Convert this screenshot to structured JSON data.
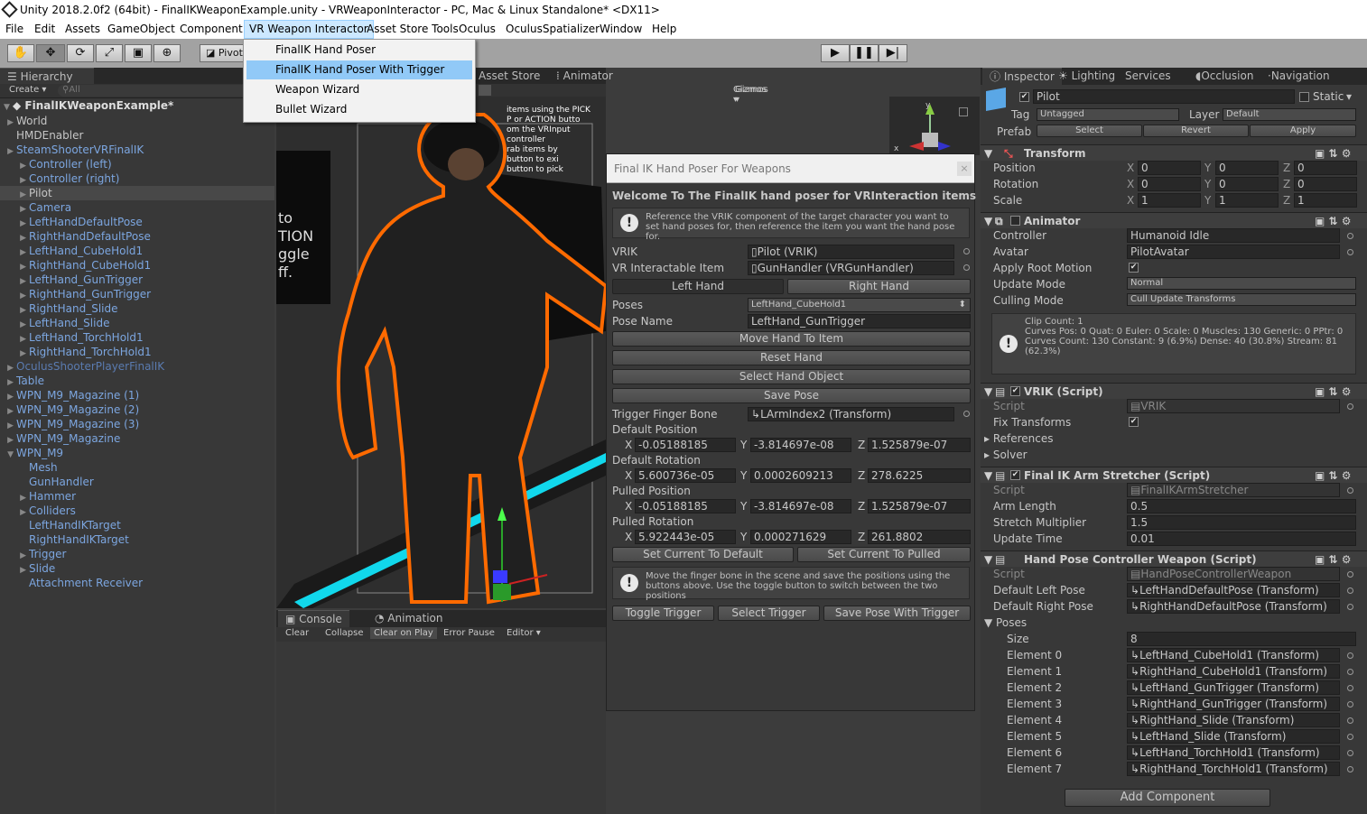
{
  "window": {
    "title": "Unity 2018.2.0f2 (64bit) - FinalIKWeaponExample.unity - VRWeaponInteractor - PC, Mac & Linux Standalone* <DX11>"
  },
  "menubar": [
    "File",
    "Edit",
    "Assets",
    "GameObject",
    "Component",
    "VR Weapon Interactor",
    "Asset Store Tools",
    "Oculus",
    "OculusSpatializer",
    "Window",
    "Help"
  ],
  "dropdown": [
    "FinalIK Hand Poser",
    "FinalIK Hand Poser With Trigger",
    "Weapon Wizard",
    "Bullet Wizard"
  ],
  "toolbar": {
    "pivot": "Pivot"
  },
  "hierarchy": {
    "tab": "Hierarchy",
    "create": "Create",
    "search": "All",
    "scene": "FinalIKWeaponExample*",
    "items": [
      {
        "label": "World",
        "indent": 1,
        "color": "grey",
        "arrow": true
      },
      {
        "label": "HMDEnabler",
        "indent": 1,
        "color": "grey",
        "arrow": false
      },
      {
        "label": "SteamShooterVRFinalIK",
        "indent": 1,
        "color": "blue",
        "arrow": true
      },
      {
        "label": "Controller (left)",
        "indent": 2,
        "color": "blue",
        "arrow": true
      },
      {
        "label": "Controller (right)",
        "indent": 2,
        "color": "blue",
        "arrow": true
      },
      {
        "label": "Pilot",
        "indent": 2,
        "color": "grey",
        "arrow": true,
        "selected": true
      },
      {
        "label": "Camera",
        "indent": 2,
        "color": "blue",
        "arrow": true
      },
      {
        "label": "LeftHandDefaultPose",
        "indent": 2,
        "color": "blue",
        "arrow": true
      },
      {
        "label": "RightHandDefaultPose",
        "indent": 2,
        "color": "blue",
        "arrow": true
      },
      {
        "label": "LeftHand_CubeHold1",
        "indent": 2,
        "color": "blue",
        "arrow": true
      },
      {
        "label": "RightHand_CubeHold1",
        "indent": 2,
        "color": "blue",
        "arrow": true
      },
      {
        "label": "LeftHand_GunTrigger",
        "indent": 2,
        "color": "blue",
        "arrow": true
      },
      {
        "label": "RightHand_GunTrigger",
        "indent": 2,
        "color": "blue",
        "arrow": true
      },
      {
        "label": "RightHand_Slide",
        "indent": 2,
        "color": "blue",
        "arrow": true
      },
      {
        "label": "LeftHand_Slide",
        "indent": 2,
        "color": "blue",
        "arrow": true
      },
      {
        "label": "LeftHand_TorchHold1",
        "indent": 2,
        "color": "blue",
        "arrow": true
      },
      {
        "label": "RightHand_TorchHold1",
        "indent": 2,
        "color": "blue",
        "arrow": true
      },
      {
        "label": "OculusShooterPlayerFinalIK",
        "indent": 1,
        "color": "dimblue",
        "arrow": true
      },
      {
        "label": "Table",
        "indent": 1,
        "color": "blue",
        "arrow": true
      },
      {
        "label": "WPN_M9_Magazine (1)",
        "indent": 1,
        "color": "blue",
        "arrow": true
      },
      {
        "label": "WPN_M9_Magazine (2)",
        "indent": 1,
        "color": "blue",
        "arrow": true
      },
      {
        "label": "WPN_M9_Magazine (3)",
        "indent": 1,
        "color": "blue",
        "arrow": true
      },
      {
        "label": "WPN_M9_Magazine",
        "indent": 1,
        "color": "blue",
        "arrow": true
      },
      {
        "label": "WPN_M9",
        "indent": 1,
        "color": "blue",
        "arrow": true,
        "open": true
      },
      {
        "label": "Mesh",
        "indent": 2,
        "color": "blue",
        "arrow": false
      },
      {
        "label": "GunHandler",
        "indent": 2,
        "color": "blue",
        "arrow": false
      },
      {
        "label": "Hammer",
        "indent": 2,
        "color": "blue",
        "arrow": true
      },
      {
        "label": "Colliders",
        "indent": 2,
        "color": "blue",
        "arrow": true
      },
      {
        "label": "LeftHandIKTarget",
        "indent": 2,
        "color": "blue",
        "arrow": false
      },
      {
        "label": "RightHandIKTarget",
        "indent": 2,
        "color": "blue",
        "arrow": false
      },
      {
        "label": "Trigger",
        "indent": 2,
        "color": "blue",
        "arrow": true
      },
      {
        "label": "Slide",
        "indent": 2,
        "color": "blue",
        "arrow": true
      },
      {
        "label": "Attachment Receiver",
        "indent": 2,
        "color": "blue",
        "arrow": false
      }
    ]
  },
  "scene": {
    "tabs": [
      "Asset Store",
      "Animator"
    ],
    "gizmos": "Gizmos",
    "search": "All",
    "text_lines": [
      "items using the PICK",
      "P or ACTION butto",
      "om the VRInput",
      "controller",
      "rab items by",
      "button to exi",
      "button to pick",
      "Ttion."
    ],
    "big_text": [
      "to",
      "TION",
      "ggle",
      "ff."
    ]
  },
  "poser": {
    "title": "Final IK Hand Poser For Weapons",
    "welcome": "Welcome To The FinalIK hand poser for VRInteraction items",
    "help1": "Reference the VRIK component of the target character you want to set hand poses for, then reference the item you want the hand pose for.",
    "vrik_label": "VRIK",
    "vrik_value": "Pilot (VRIK)",
    "item_label": "VR Interactable Item",
    "item_value": "GunHandler (VRGunHandler)",
    "left_hand": "Left Hand",
    "right_hand": "Right Hand",
    "poses_label": "Poses",
    "poses_value": "LeftHand_CubeHold1",
    "pose_name_label": "Pose Name",
    "pose_name_value": "LeftHand_GunTrigger",
    "buttons": [
      "Move Hand To Item",
      "Reset Hand",
      "Select Hand Object",
      "Save Pose"
    ],
    "trigger_bone_label": "Trigger Finger Bone",
    "trigger_bone_value": "LArmIndex2 (Transform)",
    "vectors": [
      {
        "label": "Default Position",
        "x": "-0.05188185",
        "y": "-3.814697e-08",
        "z": "1.525879e-07"
      },
      {
        "label": "Default Rotation",
        "x": "5.600736e-05",
        "y": "0.0002609213",
        "z": "278.6225"
      },
      {
        "label": "Pulled Position",
        "x": "-0.05188185",
        "y": "-3.814697e-08",
        "z": "1.525879e-07"
      },
      {
        "label": "Pulled Rotation",
        "x": "5.922443e-05",
        "y": "0.000271629",
        "z": "261.8802"
      }
    ],
    "set_default": "Set Current To Default",
    "set_pulled": "Set Current To Pulled",
    "help2": "Move the finger bone in the scene and save the positions using the buttons above. Use the toggle button to switch between the two positions",
    "bottom_buttons": [
      "Toggle Trigger",
      "Select Trigger",
      "Save Pose With Trigger"
    ]
  },
  "console": {
    "tabs": [
      "Console",
      "Animation"
    ],
    "buttons": [
      "Clear",
      "Collapse",
      "Clear on Play",
      "Error Pause",
      "Editor"
    ]
  },
  "inspector": {
    "tabs": [
      "Inspector",
      "Lighting",
      "Services",
      "Occlusion",
      "Navigation"
    ],
    "name": "Pilot",
    "static": "Static",
    "tag_label": "Tag",
    "tag": "Untagged",
    "layer_label": "Layer",
    "layer": "Default",
    "prefab_label": "Prefab",
    "prefab_buttons": [
      "Select",
      "Revert",
      "Apply"
    ],
    "transform": {
      "title": "Transform",
      "rows": [
        {
          "label": "Position",
          "x": "0",
          "y": "0",
          "z": "0"
        },
        {
          "label": "Rotation",
          "x": "0",
          "y": "0",
          "z": "0"
        },
        {
          "label": "Scale",
          "x": "1",
          "y": "1",
          "z": "1"
        }
      ]
    },
    "animator": {
      "title": "Animator",
      "rows": [
        {
          "label": "Controller",
          "value": "Humanoid Idle"
        },
        {
          "label": "Avatar",
          "value": "PilotAvatar"
        },
        {
          "label": "Apply Root Motion",
          "value": "✔"
        },
        {
          "label": "Update Mode",
          "value": "Normal"
        },
        {
          "label": "Culling Mode",
          "value": "Cull Update Transforms"
        }
      ],
      "info": "Clip Count: 1\nCurves Pos: 0 Quat: 0 Euler: 0 Scale: 0 Muscles: 130 Generic: 0 PPtr: 0\nCurves Count: 130 Constant: 9 (6.9%) Dense: 40 (30.8%) Stream: 81 (62.3%)"
    },
    "vrik": {
      "title": "VRIK (Script)",
      "script_label": "Script",
      "script": "VRIK",
      "fix_label": "Fix Transforms",
      "references": "References",
      "solver": "Solver"
    },
    "stretcher": {
      "title": "Final IK Arm Stretcher (Script)",
      "script_label": "Script",
      "script": "FinalIKArmStretcher",
      "rows": [
        {
          "label": "Arm Length",
          "value": "0.5"
        },
        {
          "label": "Stretch Multiplier",
          "value": "1.5"
        },
        {
          "label": "Update Time",
          "value": "0.01"
        }
      ]
    },
    "handpose": {
      "title": "Hand Pose Controller Weapon (Script)",
      "script_label": "Script",
      "script": "HandPoseControllerWeapon",
      "left_label": "Default Left Pose",
      "left": "LeftHandDefaultPose (Transform)",
      "right_label": "Default Right Pose",
      "right": "RightHandDefaultPose (Transform)",
      "poses_label": "Poses",
      "size_label": "Size",
      "size": "8",
      "elements": [
        {
          "label": "Element 0",
          "value": "LeftHand_CubeHold1 (Transform)"
        },
        {
          "label": "Element 1",
          "value": "RightHand_CubeHold1 (Transform)"
        },
        {
          "label": "Element 2",
          "value": "LeftHand_GunTrigger (Transform)"
        },
        {
          "label": "Element 3",
          "value": "RightHand_GunTrigger (Transform)"
        },
        {
          "label": "Element 4",
          "value": "RightHand_Slide (Transform)"
        },
        {
          "label": "Element 5",
          "value": "LeftHand_Slide (Transform)"
        },
        {
          "label": "Element 6",
          "value": "LeftHand_TorchHold1 (Transform)"
        },
        {
          "label": "Element 7",
          "value": "RightHand_TorchHold1 (Transform)"
        }
      ]
    },
    "add_component": "Add Component"
  }
}
